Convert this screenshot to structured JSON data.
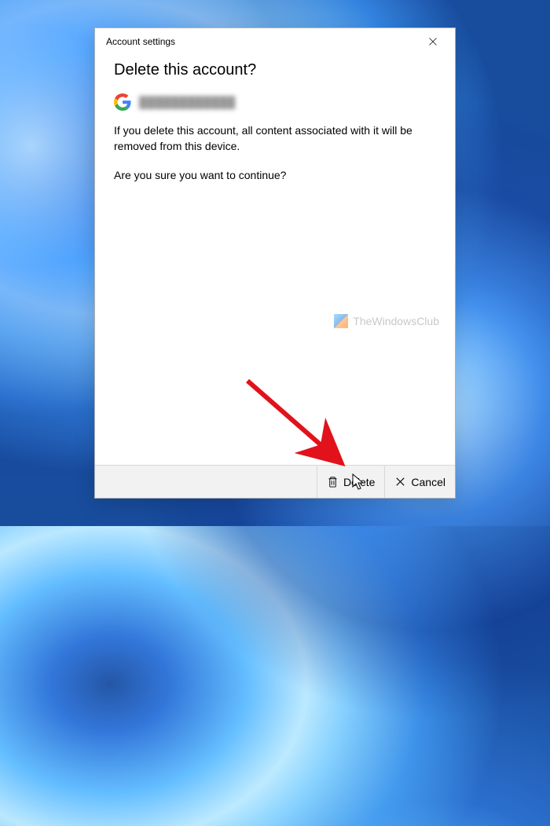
{
  "titlebar": {
    "title": "Account settings"
  },
  "dialog": {
    "heading": "Delete this account?",
    "account_email": "████████████",
    "body1": "If you delete this account, all content associated with it will be removed from this device.",
    "body2": "Are you sure you want to continue?"
  },
  "watermark": {
    "text": "TheWindowsClub"
  },
  "footer": {
    "delete_label": "Delete",
    "cancel_label": "Cancel"
  }
}
